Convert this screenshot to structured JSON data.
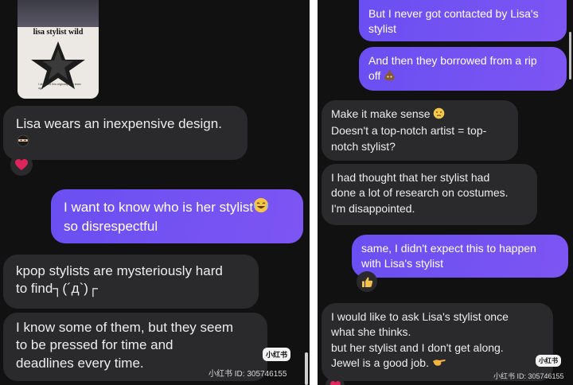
{
  "left": {
    "image_card": {
      "caption": "lisa stylist wild",
      "note": "I designed this originally as a team ago"
    },
    "messages": [
      {
        "lines": [
          "Lisa wears an inexpensive design."
        ]
      },
      {
        "lines": [
          "I want to know who is her stylist",
          "so disrespectful"
        ]
      },
      {
        "lines": [
          "kpop stylists are mysteriously hard",
          "to find┐(´д`)┌"
        ]
      },
      {
        "lines": [
          "I know some of them, but they seem",
          "to be pressed for time and",
          "deadlines every time."
        ]
      }
    ],
    "watermark": {
      "logo": "小红书",
      "text": "小红书 ID: 305746155"
    }
  },
  "right": {
    "messages": [
      {
        "lines": [
          "But I never got contacted by Lisa's",
          "stylist"
        ]
      },
      {
        "lines": [
          "And then they borrowed from a rip",
          "off"
        ]
      },
      {
        "lines": [
          "Make it make sense",
          "Doesn't a top-notch artist = top-",
          "notch stylist?"
        ]
      },
      {
        "lines": [
          "I had thought that her stylist had",
          "done a lot of research on costumes.",
          "I'm disappointed."
        ]
      },
      {
        "lines": [
          "same, I didn't expect this to happen",
          "with Lisa's stylist"
        ]
      },
      {
        "lines": [
          "I would like to ask Lisa's stylist once",
          "what she thinks.",
          "but her stylist and I don't get along.",
          "Jewel is a good job."
        ]
      }
    ],
    "watermark": {
      "logo": "小红书",
      "text": "小红书 ID: 305746155"
    }
  },
  "icons": {
    "heart_reaction": "heart-icon",
    "thumbs_up_reaction": "thumbs-up-icon",
    "poop": "poop-emoji-icon",
    "face": "face-emoji-icon",
    "tears_of_joy": "tears-of-joy-emoji-icon",
    "hand": "pointing-hand-emoji-icon",
    "ninja": "ninja-emoji-icon"
  },
  "colors": {
    "background": "#111112",
    "incoming_bubble": "#2a2a2d",
    "outgoing_bubble": "#7354f3",
    "heart": "#e0245e"
  }
}
